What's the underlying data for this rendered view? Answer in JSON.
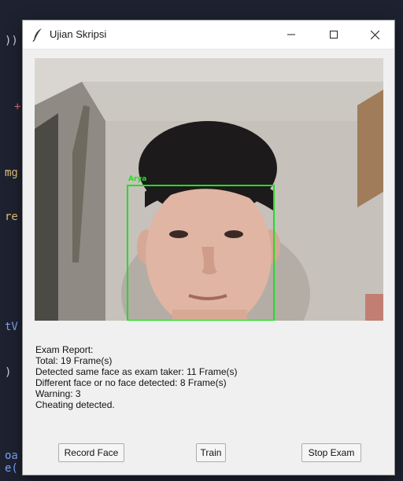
{
  "editor": {
    "fragments": [
      "))",
      "+",
      "mg",
      "re",
      "tV",
      ")",
      "oa",
      "e("
    ]
  },
  "window": {
    "title": "Ujian Skripsi",
    "icon": "feather-icon",
    "controls": [
      "minimize-icon",
      "maximize-icon",
      "close-icon"
    ]
  },
  "camera": {
    "detected_name": "Arya",
    "box_color": "#1ee01e"
  },
  "report": {
    "heading": "Exam Report:",
    "total": "Total: 19 Frame(s)",
    "same_face": "Detected same face as exam taker: 11 Frame(s)",
    "different_face": "Different face or no face detected: 8 Frame(s)",
    "warning": "Warning: 3",
    "verdict": "Cheating detected."
  },
  "buttons": {
    "record": "Record Face",
    "train": "Train",
    "stop": "Stop Exam"
  }
}
